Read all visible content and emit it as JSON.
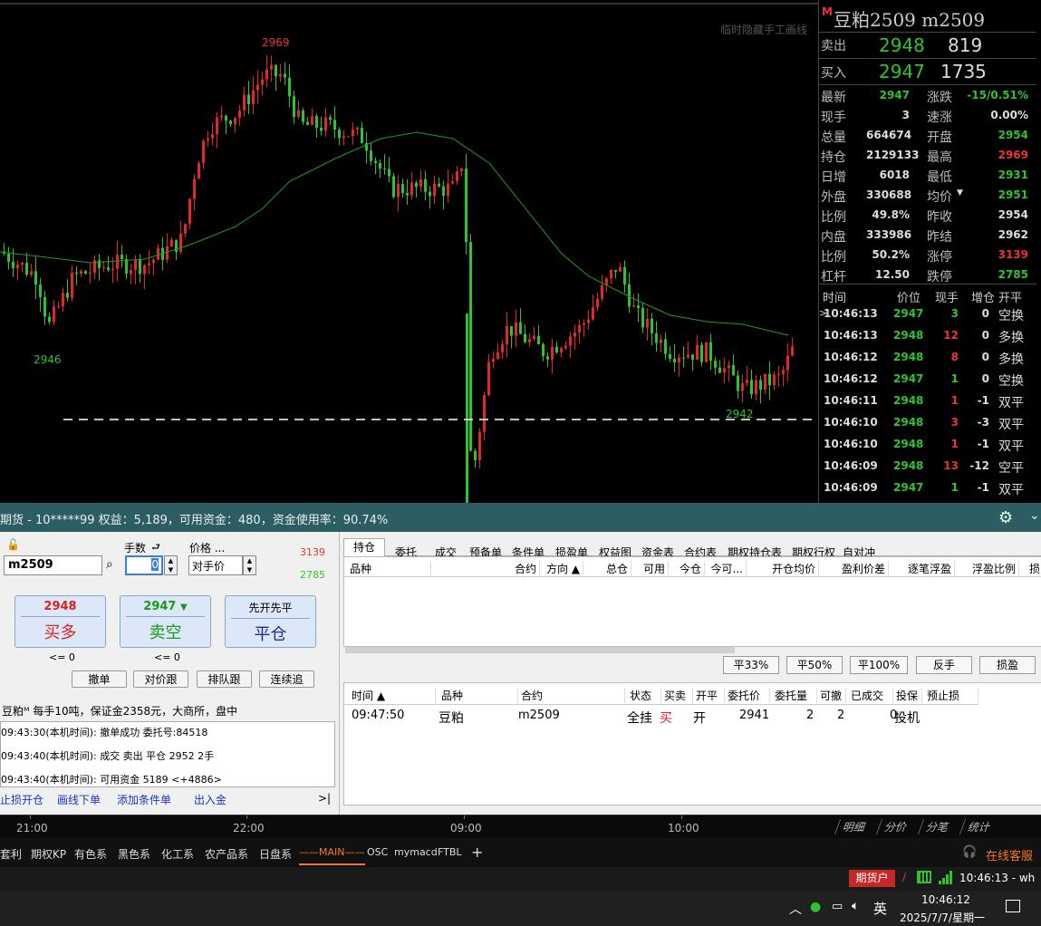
{
  "chart": {
    "hide_tip": "临时隐藏手工画线",
    "labels": {
      "high": "2969",
      "low1": "2946",
      "low2": "2942"
    },
    "colors": {
      "up": "#e32626",
      "down": "#2ec42e",
      "ma": "#1f9d1f",
      "dash": "#ffffff"
    }
  },
  "quote": {
    "logo": "M",
    "title": "豆粕2509 m2509",
    "ask_label": "卖出",
    "ask_price": "2948",
    "ask_vol": "819",
    "bid_label": "买入",
    "bid_price": "2947",
    "bid_vol": "1735",
    "rows": [
      {
        "l1": "最新",
        "v1": "2947",
        "c1": "green",
        "l2": "涨跌",
        "v2": "-15/0.51%",
        "c2": "green"
      },
      {
        "l1": "现手",
        "v1": "3",
        "c1": "white",
        "l2": "速涨",
        "v2": "0.00%",
        "c2": "white"
      },
      {
        "l1": "总量",
        "v1": "664674",
        "c1": "white",
        "l2": "开盘",
        "v2": "2954",
        "c2": "green"
      },
      {
        "l1": "持仓",
        "v1": "2129133",
        "c1": "white",
        "l2": "最高",
        "v2": "2969",
        "c2": "red"
      },
      {
        "l1": "日增",
        "v1": "6018",
        "c1": "white",
        "l2": "最低",
        "v2": "2931",
        "c2": "green"
      },
      {
        "l1": "外盘",
        "v1": "330688",
        "c1": "white",
        "l2": "均价",
        "v2": "2951",
        "c2": "green"
      },
      {
        "l1": "比例",
        "v1": "49.8%",
        "c1": "white",
        "l2": "昨收",
        "v2": "2954",
        "c2": "white"
      },
      {
        "l1": "内盘",
        "v1": "333986",
        "c1": "white",
        "l2": "昨结",
        "v2": "2962",
        "c2": "white"
      },
      {
        "l1": "比例",
        "v1": "50.2%",
        "c1": "white",
        "l2": "涨停",
        "v2": "3139",
        "c2": "red"
      },
      {
        "l1": "杠杆",
        "v1": "12.50",
        "c1": "white",
        "l2": "跌停",
        "v2": "2785",
        "c2": "green"
      }
    ],
    "tick_headers": [
      "时间",
      "价位",
      "现手",
      "增仓",
      "开平"
    ],
    "ticks": [
      {
        "time": "10:46:13",
        "price": "2947",
        "pc": "green",
        "vol": "3",
        "vc": "green",
        "inc": "0",
        "type": "空换"
      },
      {
        "time": "10:46:13",
        "price": "2948",
        "pc": "green",
        "vol": "12",
        "vc": "red",
        "inc": "0",
        "type": "多换"
      },
      {
        "time": "10:46:12",
        "price": "2948",
        "pc": "green",
        "vol": "8",
        "vc": "red",
        "inc": "0",
        "type": "多换"
      },
      {
        "time": "10:46:12",
        "price": "2947",
        "pc": "green",
        "vol": "1",
        "vc": "green",
        "inc": "0",
        "type": "空换"
      },
      {
        "time": "10:46:11",
        "price": "2948",
        "pc": "green",
        "vol": "1",
        "vc": "red",
        "inc": "-1",
        "type": "双平"
      },
      {
        "time": "10:46:10",
        "price": "2948",
        "pc": "green",
        "vol": "3",
        "vc": "red",
        "inc": "-3",
        "type": "双平"
      },
      {
        "time": "10:46:10",
        "price": "2948",
        "pc": "green",
        "vol": "1",
        "vc": "red",
        "inc": "-1",
        "type": "双平"
      },
      {
        "time": "10:46:09",
        "price": "2948",
        "pc": "green",
        "vol": "13",
        "vc": "red",
        "inc": "-12",
        "type": "空平"
      },
      {
        "time": "10:46:09",
        "price": "2947",
        "pc": "green",
        "vol": "1",
        "vc": "green",
        "inc": "-1",
        "type": "双平"
      }
    ]
  },
  "account": {
    "text": "期货 - 10*****99  权益：5,189，可用资金：480，资金使用率：90.74%"
  },
  "order": {
    "qty_label": "手数",
    "price_label": "价格 ...",
    "upper_limit": "3139",
    "lower_limit": "2785",
    "contract_value": "m2509",
    "qty_value": "0",
    "price_value": "对手价",
    "buy_price": "2948",
    "buy_label": "买多",
    "buy_note": "<= 0",
    "sell_price": "2947",
    "sell_label": "卖空",
    "sell_note": "<= 0",
    "close_hint": "先开先平",
    "close_label": "平仓",
    "actions": [
      "撤单",
      "对价跟",
      "排队跟",
      "连续追"
    ],
    "info": "豆粕ᴹ 每手10吨，保证金2358元，大商所，盘中",
    "logs": [
      "09:43:30(本机时间): 撤单成功 委托号:84518",
      "09:43:40(本机时间): 成交 卖出 平仓 2952 2手",
      "09:43:40(本机时间): 可用资金 5189 <+4886>"
    ],
    "links": [
      "止损开仓",
      "画线下单",
      "添加条件单",
      "出入金"
    ],
    "more": ">|"
  },
  "positions": {
    "tabs": [
      "持仓",
      "委托",
      "成交",
      "预备单",
      "条件单",
      "损盈单",
      "权益图",
      "资金表",
      "合约表",
      "期权持仓表",
      "期权行权",
      "自对冲"
    ],
    "headers": [
      "品种",
      "合约",
      "方向 ▲",
      "总仓",
      "可用",
      "今仓",
      "今可...",
      "开仓均价",
      "盈利价差",
      "逐笔浮盈",
      "浮盈比例",
      "损"
    ],
    "actions": [
      "平33%",
      "平50%",
      "平100%",
      "反手",
      "损盈"
    ]
  },
  "orders": {
    "headers": [
      "时间 ▲",
      "品种",
      "合约",
      "状态",
      "买卖",
      "开平",
      "委托价",
      "委托量",
      "可撤",
      "已成交",
      "投保",
      "预止损"
    ],
    "row": {
      "time": "09:47:50",
      "name": "豆粕",
      "contract": "m2509",
      "status": "全挂",
      "side": "买",
      "oc": "开",
      "price": "2941",
      "qty": "2",
      "cancelable": "2",
      "filled": "0",
      "hedge": "投机"
    }
  },
  "timeaxis": {
    "ticks": [
      "21:00",
      "22:00",
      "09:00",
      "10:00"
    ],
    "tabs": [
      "明细",
      "分价",
      "分笔",
      "统计"
    ]
  },
  "tabbar": {
    "items": [
      "套利",
      "期权KP",
      "有色系",
      "黑色系",
      "化工系",
      "农产品系",
      "日盘系",
      "——MAIN——",
      "OSC",
      "mymacd",
      "FTBL",
      "+"
    ],
    "service": "在线客服"
  },
  "status": {
    "account": "期货户",
    "sep": "/",
    "time": "10:46:13 - wh"
  },
  "taskbar": {
    "ime": "英",
    "time": "10:46:12",
    "date": "2025/7/7/星期一"
  }
}
